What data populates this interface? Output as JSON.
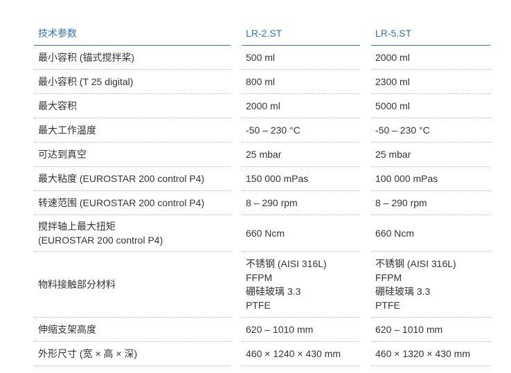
{
  "header": {
    "col1": "技术参数",
    "col2": "LR-2.ST",
    "col3": "LR-5.ST"
  },
  "rows": [
    {
      "label": "最小容积 (锚式搅拌桨)",
      "v1": "500 ml",
      "v2": "2000 ml"
    },
    {
      "label": "最小容积 (T 25 digital)",
      "v1": "800 ml",
      "v2": "2300 ml"
    },
    {
      "label": "最大容积",
      "v1": "2000 ml",
      "v2": "5000 ml"
    },
    {
      "label": "最大工作温度",
      "v1": "-50 – 230 °C",
      "v2": "-50 – 230 °C"
    },
    {
      "label": "可达到真空",
      "v1": "25 mbar",
      "v2": "25 mbar"
    },
    {
      "label": "最大粘度 (EUROSTAR 200 control P4)",
      "v1": "150 000 mPas",
      "v2": "100 000 mPas"
    },
    {
      "label": "转速范围 (EUROSTAR 200 control P4)",
      "v1": "8 – 290 rpm",
      "v2": "8 – 290 rpm"
    },
    {
      "label_lines": [
        "搅拌轴上最大扭矩",
        "(EUROSTAR 200 control P4)"
      ],
      "v1": "660 Ncm",
      "v2": "660 Ncm"
    },
    {
      "label": "物料接触部分材料",
      "v1_lines": [
        "不锈钢 (AISI 316L)",
        "FFPM",
        "硼硅玻璃 3.3",
        "PTFE"
      ],
      "v2_lines": [
        "不锈钢 (AISI 316L)",
        "FFPM",
        "硼硅玻璃 3.3",
        "PTFE"
      ]
    },
    {
      "label": "伸缩支架高度",
      "v1": "620 – 1010 mm",
      "v2": "620 – 1010 mm"
    },
    {
      "label": "外形尺寸 (宽 × 高 × 深)",
      "v1": "460 × 1240 × 430 mm",
      "v2": "460 × 1320 × 430 mm"
    }
  ],
  "colors": {
    "header_text": "#2e74b5",
    "header_rule": "#2e74b5",
    "body_text": "#333333",
    "row_divider": "#b9b9b9"
  }
}
